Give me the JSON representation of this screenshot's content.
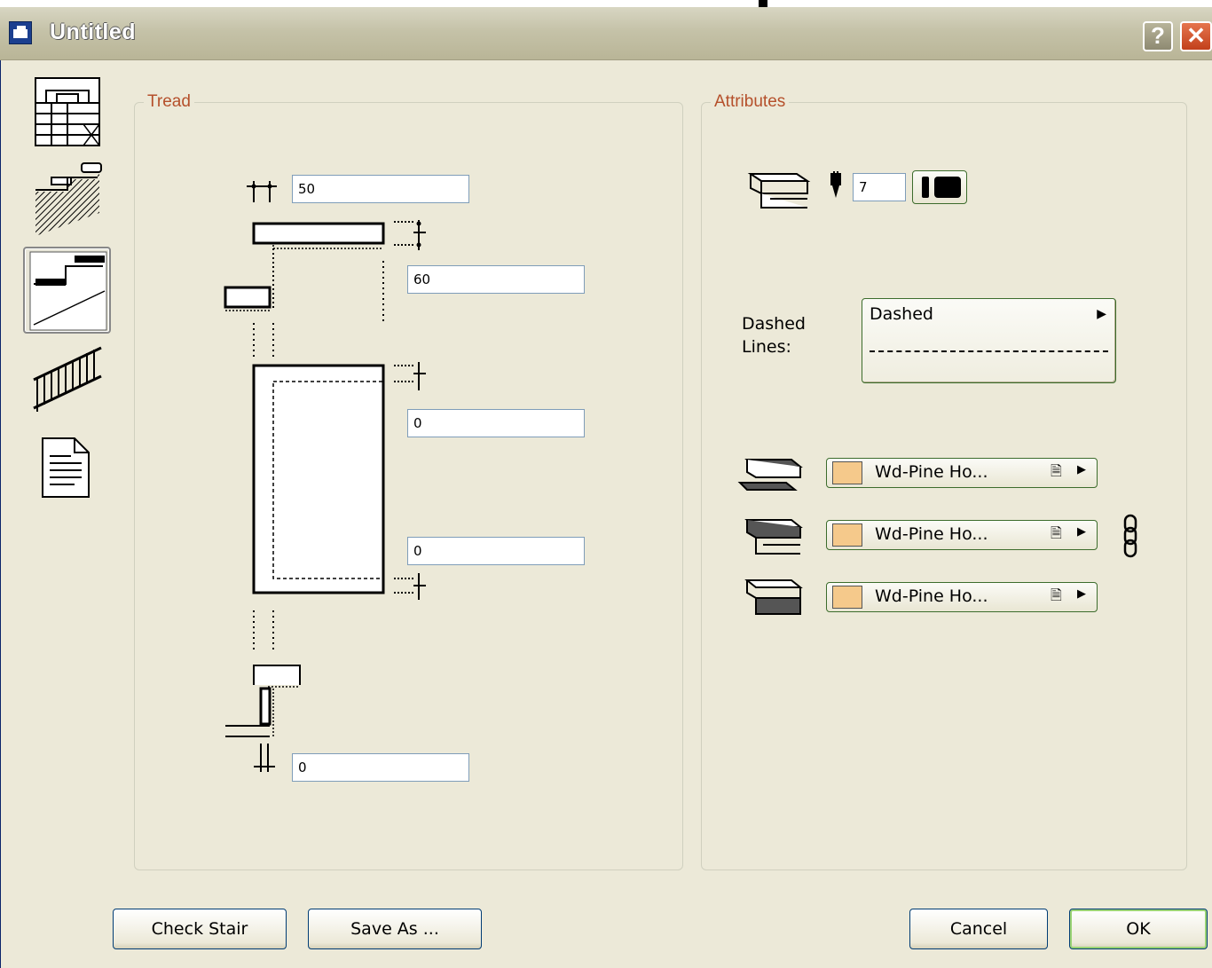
{
  "window": {
    "title": "Untitled",
    "help_label": "?",
    "close_label": "✕"
  },
  "sidebar": {
    "items": [
      {
        "icon": "stair-plan-icon",
        "selected": false
      },
      {
        "icon": "stair-structure-icon",
        "selected": false
      },
      {
        "icon": "tread-icon",
        "selected": true
      },
      {
        "icon": "railing-icon",
        "selected": false
      },
      {
        "icon": "listing-icon",
        "selected": false
      }
    ]
  },
  "tread": {
    "legend": "Tread",
    "thickness": "50",
    "nosing": "60",
    "offset_top": "0",
    "offset_bottom": "0",
    "bottom_value": "0"
  },
  "attributes": {
    "legend": "Attributes",
    "pen_number": "7",
    "dashed_label": "Dashed Lines:",
    "dashed_value": "Dashed",
    "materials": [
      {
        "name": "Wd-Pine Ho...",
        "color": "#f5c98b"
      },
      {
        "name": "Wd-Pine Ho...",
        "color": "#f5c98b"
      },
      {
        "name": "Wd-Pine Ho...",
        "color": "#f5c98b"
      }
    ],
    "link_icon": "chain-link-icon"
  },
  "buttons": {
    "check_stair": "Check Stair",
    "save_as": "Save As ...",
    "cancel": "Cancel",
    "ok": "OK"
  }
}
